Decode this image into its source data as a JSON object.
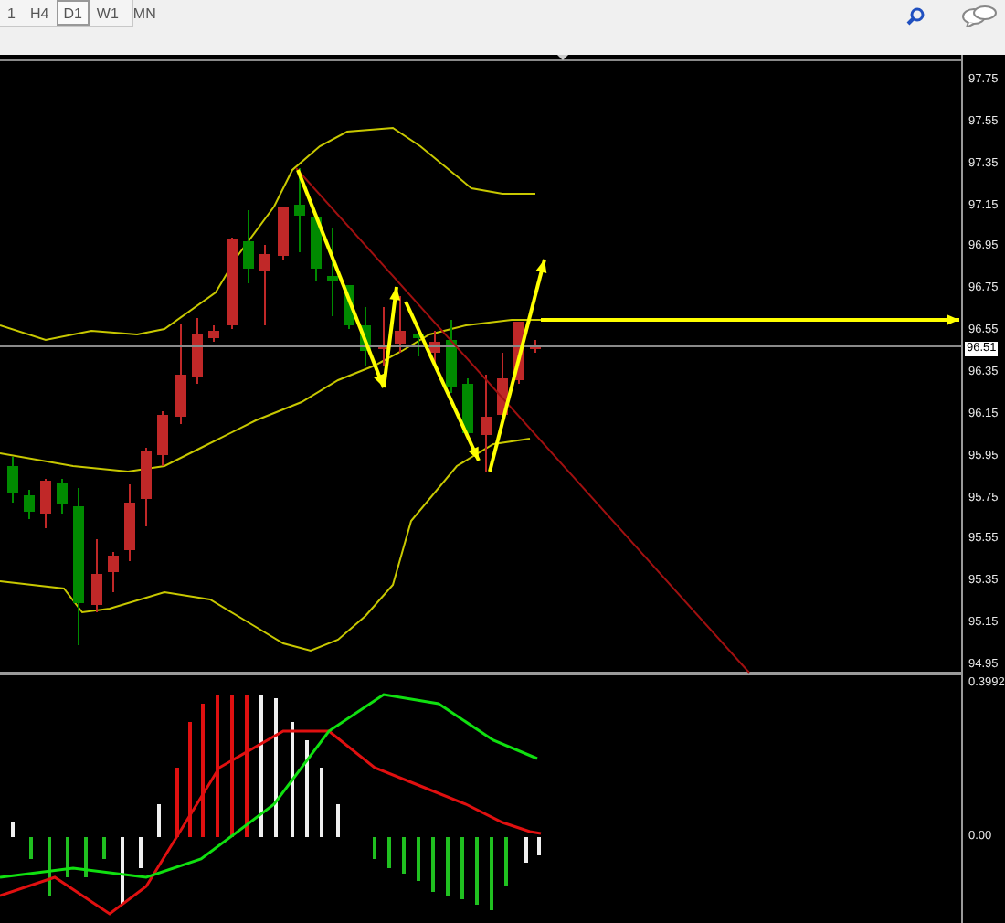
{
  "toolbar": {
    "timeframes": [
      {
        "label": "1",
        "selected": false
      },
      {
        "label": "H4",
        "selected": false
      },
      {
        "label": "D1",
        "selected": true
      },
      {
        "label": "W1",
        "selected": false
      },
      {
        "label": "MN",
        "selected": false
      }
    ]
  },
  "price_chart": {
    "axis_labels": [
      "97.75",
      "97.55",
      "97.35",
      "97.15",
      "96.95",
      "96.75",
      "96.55",
      "96.35",
      "96.15",
      "95.95",
      "95.75",
      "95.55",
      "95.35",
      "95.15",
      "94.95"
    ],
    "current_price": "96.51"
  },
  "indicator": {
    "axis_labels": [
      "0.3992",
      "0.00"
    ]
  }
}
